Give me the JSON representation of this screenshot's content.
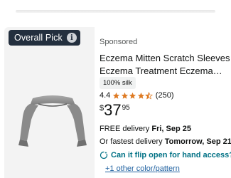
{
  "badge": {
    "label": "Overall Pick",
    "info_icon": "info-icon"
  },
  "product": {
    "sponsored": "Sponsored",
    "title_line1": "Eczema Mitten Scratch Sleeves |",
    "title_line2": "Eczema Treatment Eczema…",
    "material_badge": "100% silk",
    "rating": "4.4",
    "rating_value": 4.4,
    "rating_max": 5,
    "review_count": "(250)",
    "price_symbol": "$",
    "price_whole": "37",
    "price_fraction": "95",
    "delivery_prefix": "FREE delivery ",
    "delivery_date": "Fri, Sep 25",
    "fastest_prefix": "Or fastest delivery ",
    "fastest_date": "Tomorrow, Sep 21",
    "question": "Can it flip open for hand access?",
    "other_options": "+1 other color/pattern"
  },
  "colors": {
    "badge_bg": "#232f3e",
    "star": "#de7921",
    "link": "#007185",
    "option_link": "#2162a1"
  },
  "icons": {
    "question": "ai-sparkle-icon",
    "star": "star-icon"
  }
}
